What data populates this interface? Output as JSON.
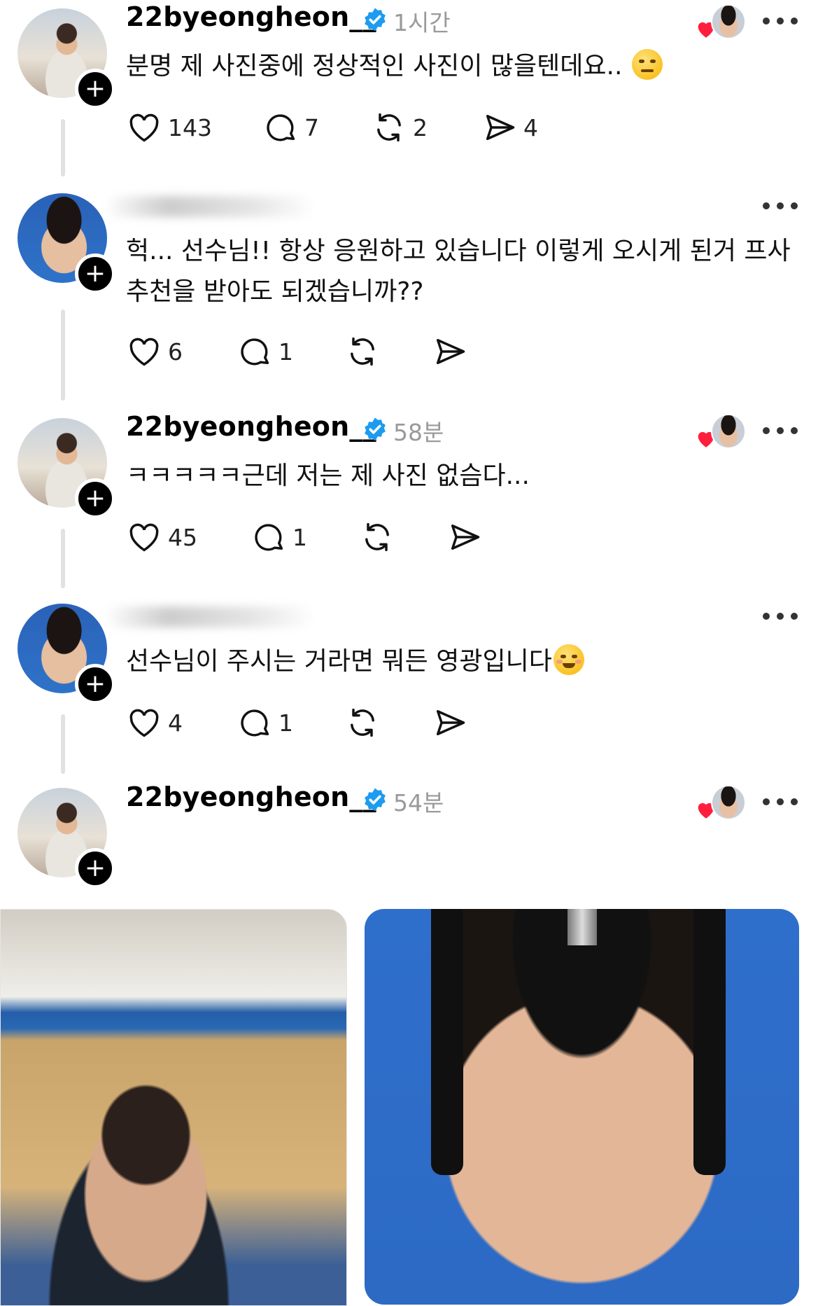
{
  "posts": [
    {
      "username": "22byeongheon__",
      "timestamp": "1시간",
      "text": "분명 제 사진중에 정상적인 사진이 많을텐데요..",
      "emoji_icon": "face-with-raised-eyebrow-emoji",
      "likes": "143",
      "replies": "7",
      "reposts": "2",
      "shares": "4"
    },
    {
      "username": "",
      "text_line1": "헉... 선수님!! 항상 응원하고 있습니다 이렇게 오시게 된거 프사",
      "text_line2": "추천을 받아도 되겠습니까??",
      "likes": "6",
      "replies": "1"
    },
    {
      "username": "22byeongheon__",
      "timestamp": "58분",
      "text": "ㅋㅋㅋㅋㅋ근데 저는 제 사진 없슴다...",
      "likes": "45",
      "replies": "1"
    },
    {
      "username": "",
      "text": "선수님이 주시는 거라면 뭐든 영광입니다",
      "emoji_icon": "smiling-face-emoji",
      "likes": "4",
      "replies": "1"
    },
    {
      "username": "22byeongheon__",
      "timestamp": "54분"
    }
  ],
  "colors": {
    "verified": "#1d9bf0",
    "heart": "#ff1f3d",
    "thread_line": "#e1e1e1",
    "timestamp": "#9a9a9a"
  }
}
